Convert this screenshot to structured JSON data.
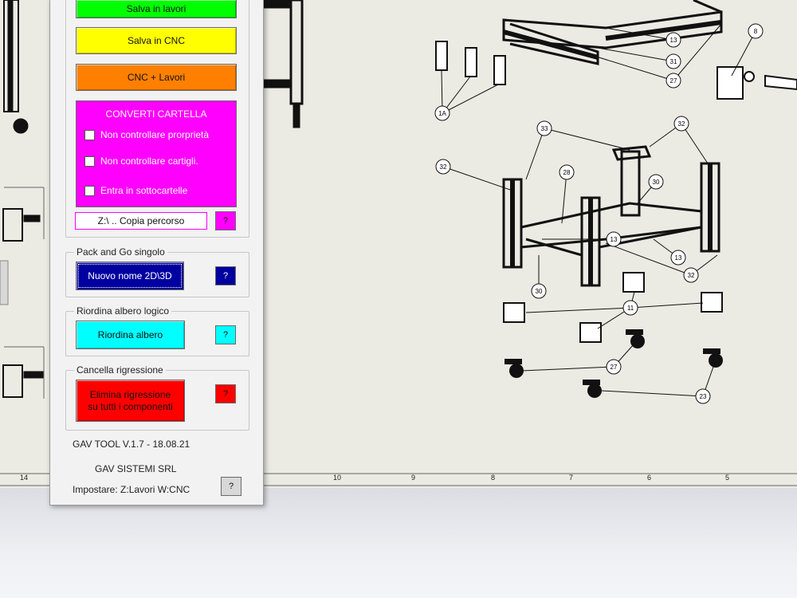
{
  "panel": {
    "btn_salva_lavori": "Salva in lavori",
    "btn_salva_cnc": "Salva in CNC",
    "btn_cnc_lavori": "CNC + Lavori",
    "converti": {
      "title": "CONVERTI CARTELLA",
      "opt1": "Non controllare prorprietà",
      "opt2": "Non controllare cartigli.",
      "opt3": "Entra in sottocartelle"
    },
    "copy_path": "Z:\\ .. Copia percorso",
    "help": "?",
    "pack_group": "Pack and Go singolo",
    "pack_btn": "Nuovo nome 2D\\3D",
    "reorder_group": "Riordina albero logico",
    "reorder_btn": "Riordina albero",
    "cancel_group": "Cancella rigressione",
    "cancel_btn_line1": "Elimina rigressione",
    "cancel_btn_line2": "su tutti i componenti",
    "version": "GAV TOOL V.1.7 - 18.08.21",
    "company": "GAV SISTEMI SRL",
    "settings": "Impostare:  Z:Lavori  W:CNC"
  },
  "ruler": [
    "14",
    "10",
    "9",
    "8",
    "7",
    "6",
    "5"
  ],
  "balloons": [
    "13",
    "31",
    "27",
    "8",
    "1A",
    "33",
    "32",
    "32",
    "28",
    "30",
    "13",
    "13",
    "32",
    "30",
    "11",
    "27",
    "23"
  ],
  "colors": {
    "green": "#00ff00",
    "yellow": "#ffff00",
    "orange": "#ff8000",
    "magenta": "#ff00ff",
    "navy": "#0000a0",
    "cyan": "#00ffff",
    "red": "#ff0000"
  }
}
